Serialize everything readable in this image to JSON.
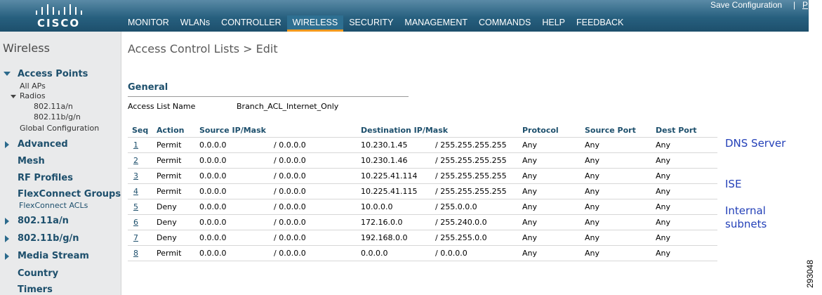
{
  "header": {
    "logo_text": "CISCO",
    "save_configuration": "Save Configuration",
    "separator": "|",
    "truncated_link": "P",
    "nav": [
      {
        "label": "MONITOR"
      },
      {
        "label": "WLANs"
      },
      {
        "label": "CONTROLLER"
      },
      {
        "label": "WIRELESS",
        "active": true
      },
      {
        "label": "SECURITY"
      },
      {
        "label": "MANAGEMENT"
      },
      {
        "label": "COMMANDS"
      },
      {
        "label": "HELP"
      },
      {
        "label": "FEEDBACK"
      }
    ]
  },
  "sidebar": {
    "title": "Wireless",
    "access_points": "Access Points",
    "all_aps": "All APs",
    "radios": "Radios",
    "radio_a": "802.11a/n",
    "radio_b": "802.11b/g/n",
    "global_configuration": "Global Configuration",
    "advanced": "Advanced",
    "mesh": "Mesh",
    "rf_profiles": "RF Profiles",
    "flexconnect_groups": "FlexConnect Groups",
    "flexconnect_acls": "FlexConnect ACLs",
    "band_a": "802.11a/n",
    "band_b": "802.11b/g/n",
    "media_stream": "Media Stream",
    "country": "Country",
    "timers": "Timers"
  },
  "main": {
    "title": "Access Control Lists > Edit",
    "section": "General",
    "acl_name_label": "Access List Name",
    "acl_name_value": "Branch_ACL_Internet_Only",
    "columns": {
      "seq": "Seq",
      "action": "Action",
      "source": "Source IP/Mask",
      "destination": "Destination IP/Mask",
      "protocol": "Protocol",
      "source_port": "Source Port",
      "dest_port": "Dest Port"
    },
    "rows": [
      {
        "seq": "1",
        "action": "Permit",
        "src_ip": "0.0.0.0",
        "src_mask": "/ 0.0.0.0",
        "dst_ip": "10.230.1.45",
        "dst_mask": "/ 255.255.255.255",
        "protocol": "Any",
        "sport": "Any",
        "dport": "Any"
      },
      {
        "seq": "2",
        "action": "Permit",
        "src_ip": "0.0.0.0",
        "src_mask": "/ 0.0.0.0",
        "dst_ip": "10.230.1.46",
        "dst_mask": "/ 255.255.255.255",
        "protocol": "Any",
        "sport": "Any",
        "dport": "Any"
      },
      {
        "seq": "3",
        "action": "Permit",
        "src_ip": "0.0.0.0",
        "src_mask": "/ 0.0.0.0",
        "dst_ip": "10.225.41.114",
        "dst_mask": "/ 255.255.255.255",
        "protocol": "Any",
        "sport": "Any",
        "dport": "Any"
      },
      {
        "seq": "4",
        "action": "Permit",
        "src_ip": "0.0.0.0",
        "src_mask": "/ 0.0.0.0",
        "dst_ip": "10.225.41.115",
        "dst_mask": "/ 255.255.255.255",
        "protocol": "Any",
        "sport": "Any",
        "dport": "Any"
      },
      {
        "seq": "5",
        "action": "Deny",
        "src_ip": "0.0.0.0",
        "src_mask": "/ 0.0.0.0",
        "dst_ip": "10.0.0.0",
        "dst_mask": "/ 255.0.0.0",
        "protocol": "Any",
        "sport": "Any",
        "dport": "Any"
      },
      {
        "seq": "6",
        "action": "Deny",
        "src_ip": "0.0.0.0",
        "src_mask": "/ 0.0.0.0",
        "dst_ip": "172.16.0.0",
        "dst_mask": "/ 255.240.0.0",
        "protocol": "Any",
        "sport": "Any",
        "dport": "Any"
      },
      {
        "seq": "7",
        "action": "Deny",
        "src_ip": "0.0.0.0",
        "src_mask": "/ 0.0.0.0",
        "dst_ip": "192.168.0.0",
        "dst_mask": "/ 255.255.0.0",
        "protocol": "Any",
        "sport": "Any",
        "dport": "Any"
      },
      {
        "seq": "8",
        "action": "Permit",
        "src_ip": "0.0.0.0",
        "src_mask": "/ 0.0.0.0",
        "dst_ip": "0.0.0.0",
        "dst_mask": "/ 0.0.0.0",
        "protocol": "Any",
        "sport": "Any",
        "dport": "Any"
      }
    ]
  },
  "annotations": {
    "dns_server": "DNS Server",
    "ise": "ISE",
    "internal_1": "Internal",
    "internal_2": "subnets"
  },
  "figure_number": "293048",
  "colors": {
    "header_bar": "#27607f",
    "active_tab_underline": "#f29a1e",
    "link_blue": "#1d4f6c",
    "annotation_blue": "#2340b8"
  }
}
